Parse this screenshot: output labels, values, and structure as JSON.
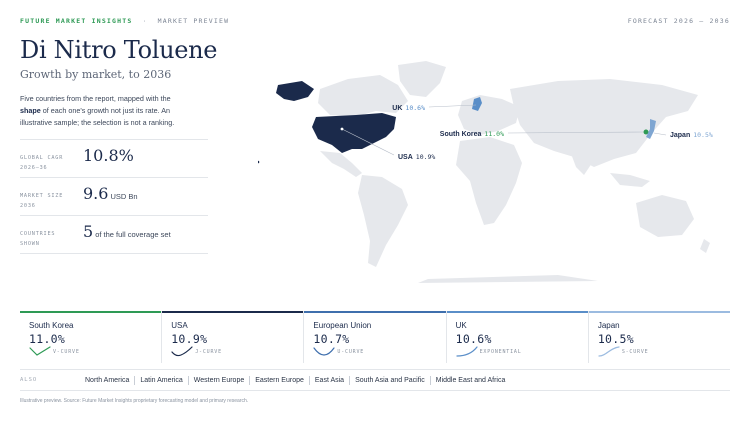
{
  "header": {
    "brand": "FUTURE MARKET INSIGHTS",
    "separator": "·",
    "section": "MARKET PREVIEW",
    "forecast": "FORECAST 2026 – 2036"
  },
  "title": "Di Nitro Toluene",
  "subtitle": "Growth by market, to 2036",
  "description": {
    "before": "Five countries from the report, mapped with the ",
    "bold": "shape",
    "after": " of each one's growth not just its rate. An illustrative sample; the selection is not a ranking."
  },
  "stats": [
    {
      "label": "GLOBAL CAGR 2026–36",
      "value": "10.8%",
      "unit": ""
    },
    {
      "label": "MARKET SIZE 2036",
      "value": "9.6",
      "unit": "USD Bn"
    },
    {
      "label": "COUNTRIES SHOWN",
      "value": "5",
      "unit": "of the full coverage set"
    }
  ],
  "map": {
    "land_color": "#e6e8ec",
    "markers": [
      {
        "name": "UK",
        "value": "10.6%",
        "color": "#5a8ec8",
        "label_side": "left"
      },
      {
        "name": "South Korea",
        "value": "11.0%",
        "color": "#2e9a55",
        "label_side": "left"
      },
      {
        "name": "Japan",
        "value": "10.5%",
        "color": "#7fa6d2",
        "label_side": "right"
      },
      {
        "name": "USA",
        "value": "10.9%",
        "color": "#1b2a4b",
        "label_side": "right"
      }
    ]
  },
  "cards": [
    {
      "name": "South Korea",
      "value": "11.0%",
      "curve": "V-CURVE",
      "shape": "v",
      "color": "#2e9a55"
    },
    {
      "name": "USA",
      "value": "10.9%",
      "curve": "J-CURVE",
      "shape": "j",
      "color": "#1b2a4b"
    },
    {
      "name": "European Union",
      "value": "10.7%",
      "curve": "U-CURVE",
      "shape": "u",
      "color": "#3f6fad"
    },
    {
      "name": "UK",
      "value": "10.6%",
      "curve": "EXPONENTIAL",
      "shape": "exp",
      "color": "#5a8ec8"
    },
    {
      "name": "Japan",
      "value": "10.5%",
      "curve": "S-CURVE",
      "shape": "s",
      "color": "#9bbbe0"
    }
  ],
  "also": {
    "label": "ALSO",
    "items": [
      "North America",
      "Latin America",
      "Western Europe",
      "Eastern Europe",
      "East Asia",
      "South Asia and Pacific",
      "Middle East and Africa"
    ]
  },
  "footnote": "Illustrative preview. Source: Future Market Insights proprietary forecasting model and primary research."
}
